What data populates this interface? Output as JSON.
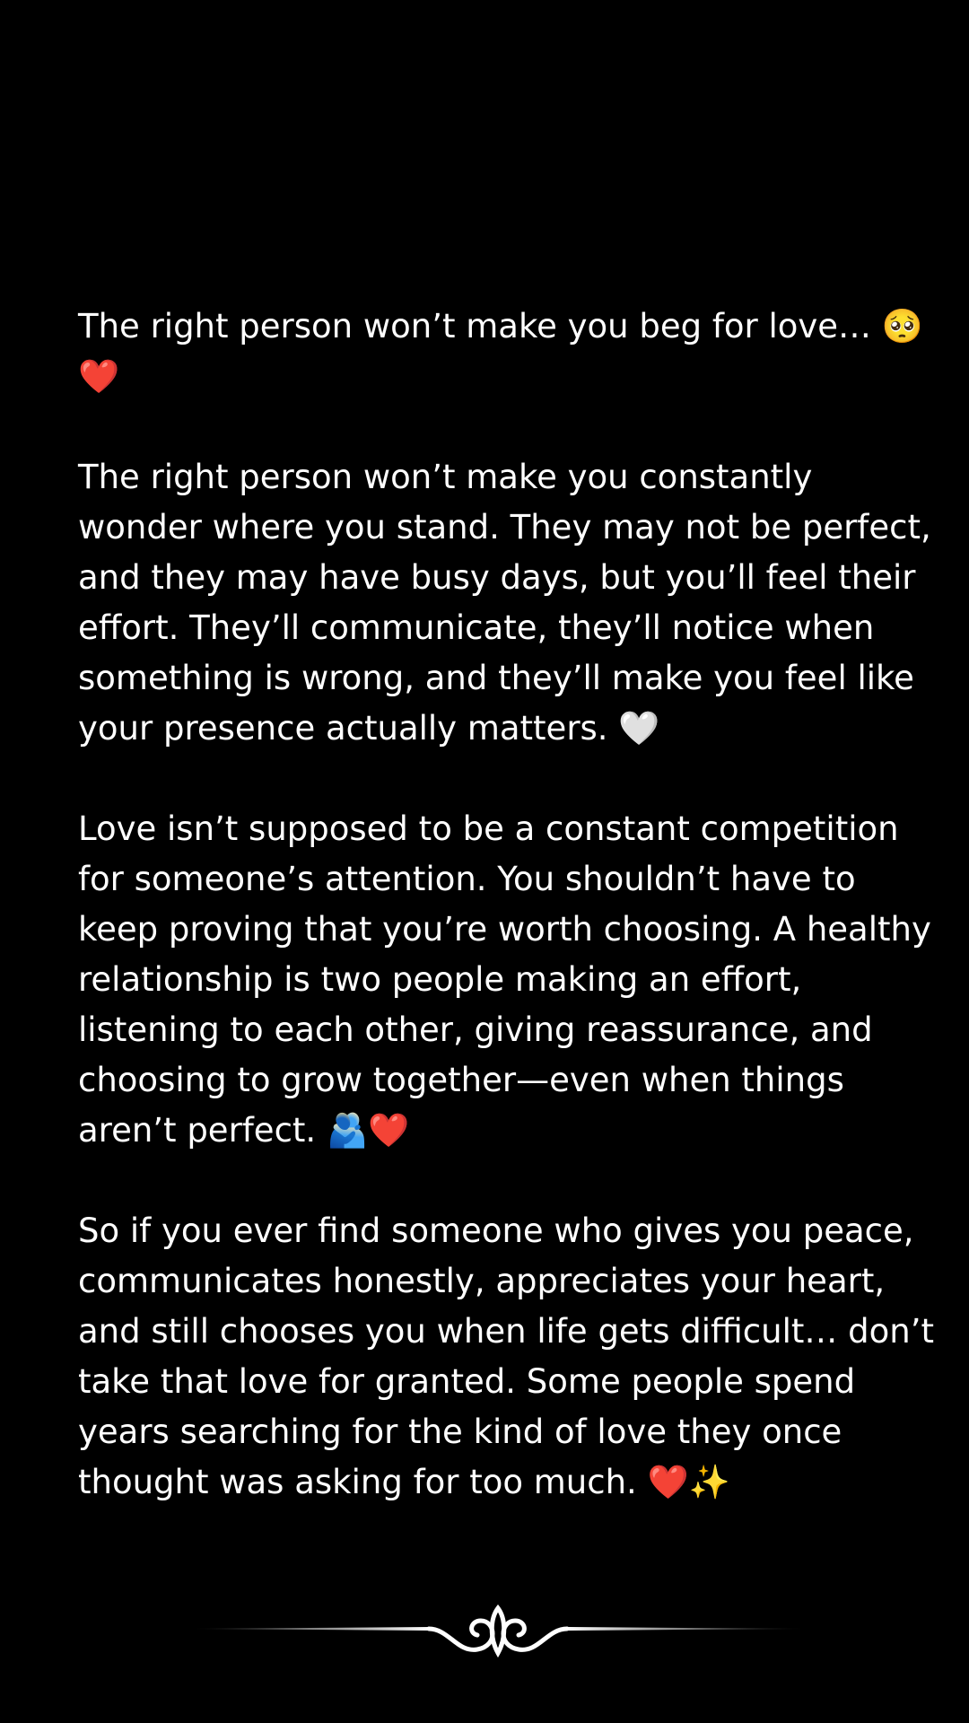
{
  "post": {
    "paragraphs": [
      {
        "text": "The right person won’t make you beg for love… ",
        "emoji": "🥺❤️"
      },
      {
        "text": "The right person won’t make you constantly wonder where you stand. They may not be perfect, and they may have busy days, but you’ll feel their effort. They’ll communicate, they’ll notice when something is wrong, and they’ll make you feel like your presence actually matters. ",
        "emoji": "🤍"
      },
      {
        "text": "Love isn’t supposed to be a constant competition for someone’s attention. You shouldn’t have to keep proving that you’re worth choosing. A healthy relationship is two people making an effort, listening to each other, giving reassurance, and choosing to grow together—even when things aren’t perfect. ",
        "emoji": "🫂❤️"
      },
      {
        "text": "So if you ever find someone who gives you peace, communicates honestly, appreciates your heart, and still chooses you when life gets difficult… don’t take that love for granted. Some people spend years searching for the kind of love they once thought was asking for too much. ",
        "emoji": "❤️✨"
      }
    ]
  },
  "ornament": {
    "icon": "scroll-divider-icon",
    "color": "#ffffff"
  },
  "colors": {
    "background": "#000000",
    "text": "#ffffff"
  }
}
